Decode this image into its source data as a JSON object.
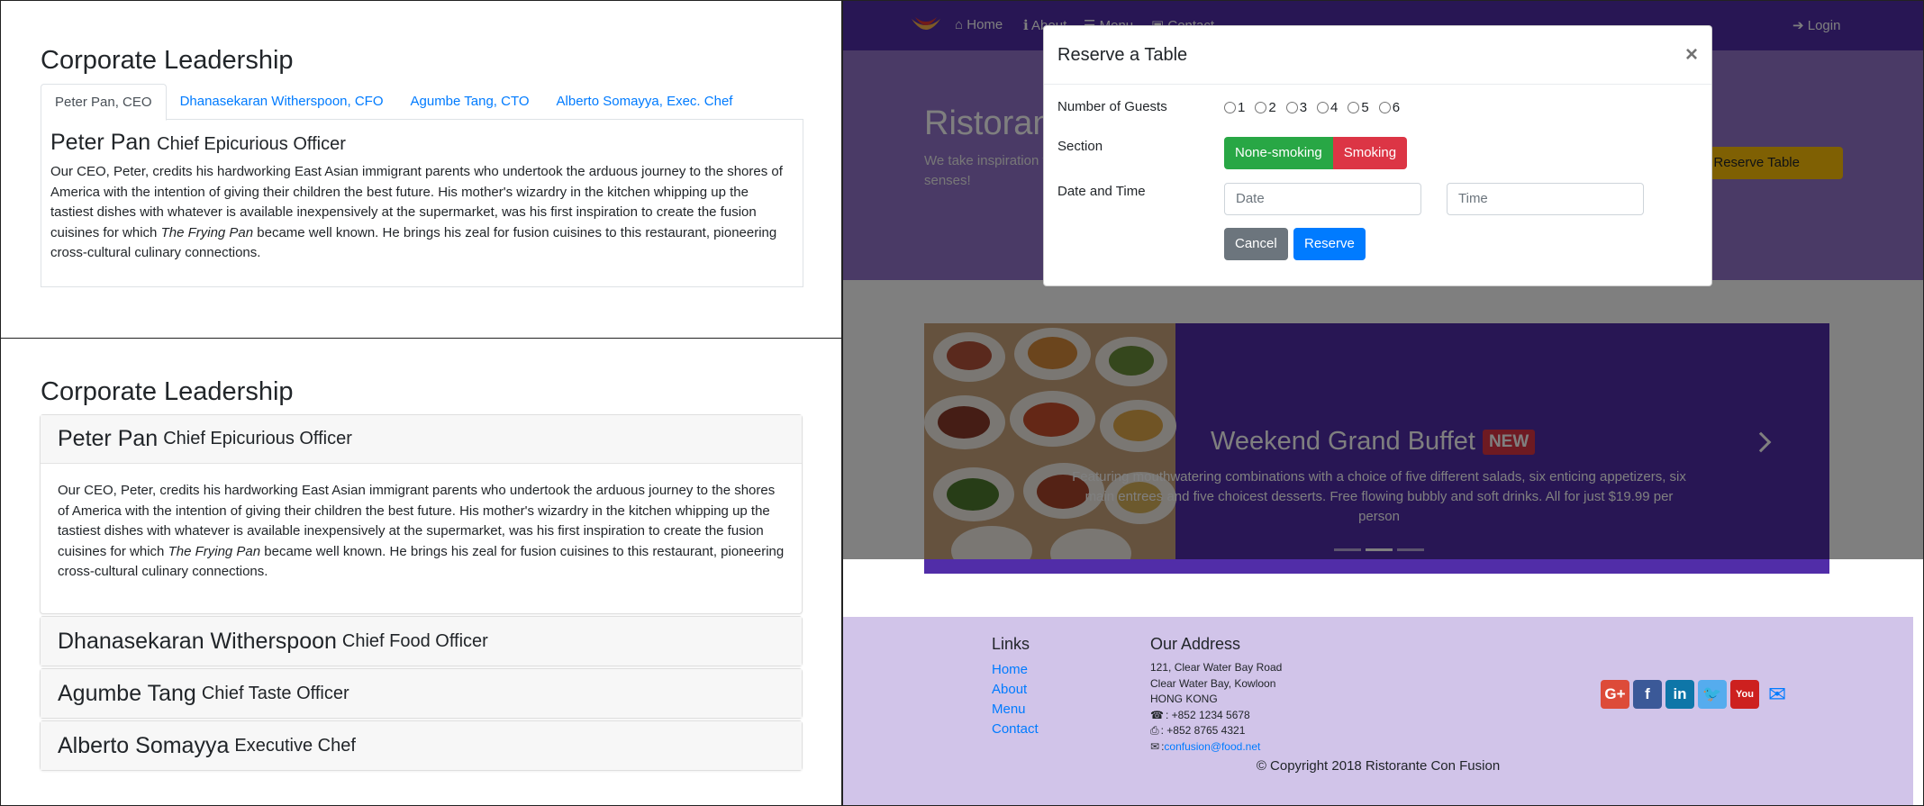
{
  "tabs_view": {
    "title": "Corporate Leadership",
    "tabs": [
      {
        "label": "Peter Pan, CEO"
      },
      {
        "label": "Dhanasekaran Witherspoon, CFO"
      },
      {
        "label": "Agumbe Tang, CTO"
      },
      {
        "label": "Alberto Somayya, Exec. Chef"
      }
    ],
    "active": {
      "name": "Peter Pan",
      "designation": "Chief Epicurious Officer",
      "desc_before": "Our CEO, Peter, credits his hardworking East Asian immigrant parents who undertook the arduous journey to the shores of America with the intention of giving their children the best future. His mother's wizardry in the kitchen whipping up the tastiest dishes with whatever is available inexpensively at the supermarket, was his first inspiration to create the fusion cuisines for which ",
      "desc_italic": "The Frying Pan",
      "desc_after": " became well known. He brings his zeal for fusion cuisines to this restaurant, pioneering cross-cultural culinary connections."
    }
  },
  "accordion_view": {
    "title": "Corporate Leadership",
    "leaders": [
      {
        "name": "Peter Pan",
        "designation": "Chief Epicurious Officer"
      },
      {
        "name": "Dhanasekaran Witherspoon",
        "designation": "Chief Food Officer"
      },
      {
        "name": "Agumbe Tang",
        "designation": "Chief Taste Officer"
      },
      {
        "name": "Alberto Somayya",
        "designation": "Executive Chef"
      }
    ],
    "expanded": {
      "desc_before": "Our CEO, Peter, credits his hardworking East Asian immigrant parents who undertook the arduous journey to the shores of America with the intention of giving their children the best future. His mother's wizardry in the kitchen whipping up the tastiest dishes with whatever is available inexpensively at the supermarket, was his first inspiration to create the fusion cuisines for which ",
      "desc_italic": "The Frying Pan",
      "desc_after": " became well known. He brings his zeal for fusion cuisines to this restaurant, pioneering cross-cultural culinary connections."
    }
  },
  "site": {
    "nav": {
      "home": "Home",
      "about": "About",
      "menu": "Menu",
      "contact": "Contact",
      "login": "Login"
    },
    "jumbotron": {
      "title": "Ristorante",
      "text": "We take inspiration fusion experience. senses!",
      "button": "Reserve Table"
    },
    "carousel": {
      "title": "Weekend Grand Buffet",
      "badge": "NEW",
      "text": "Featuring mouthwatering combinations with a choice of five different salads, six enticing appetizers, six main entrees and five choicest desserts. Free flowing bubbly and soft drinks. All for just $19.99 per person"
    },
    "footer": {
      "links_title": "Links",
      "links": [
        "Home",
        "About",
        "Menu",
        "Contact"
      ],
      "address_title": "Our Address",
      "address": [
        "121, Clear Water Bay Road",
        "Clear Water Bay, Kowloon",
        "HONG KONG"
      ],
      "phone": ": +852 1234 5678",
      "fax": ": +852 8765 4321",
      "email_prefix": ": ",
      "email": "confusion@food.net",
      "copyright": "© Copyright 2018 Ristorante Con Fusion"
    }
  },
  "modal": {
    "title": "Reserve a Table",
    "close": "×",
    "guests_label": "Number of Guests",
    "guests": [
      "1",
      "2",
      "3",
      "4",
      "5",
      "6"
    ],
    "section_label": "Section",
    "non_smoking": "None-smoking",
    "smoking": "Smoking",
    "datetime_label": "Date and Time",
    "date_placeholder": "Date",
    "time_placeholder": "Time",
    "cancel": "Cancel",
    "reserve": "Reserve"
  },
  "colors": {
    "primary": "#007bff",
    "navbar": "#512da8",
    "jumbotron": "#9575cd",
    "footer": "#d1c4e9",
    "success": "#28a745",
    "danger": "#dc3545",
    "secondary": "#6c757d",
    "warning": "#ffc107"
  }
}
